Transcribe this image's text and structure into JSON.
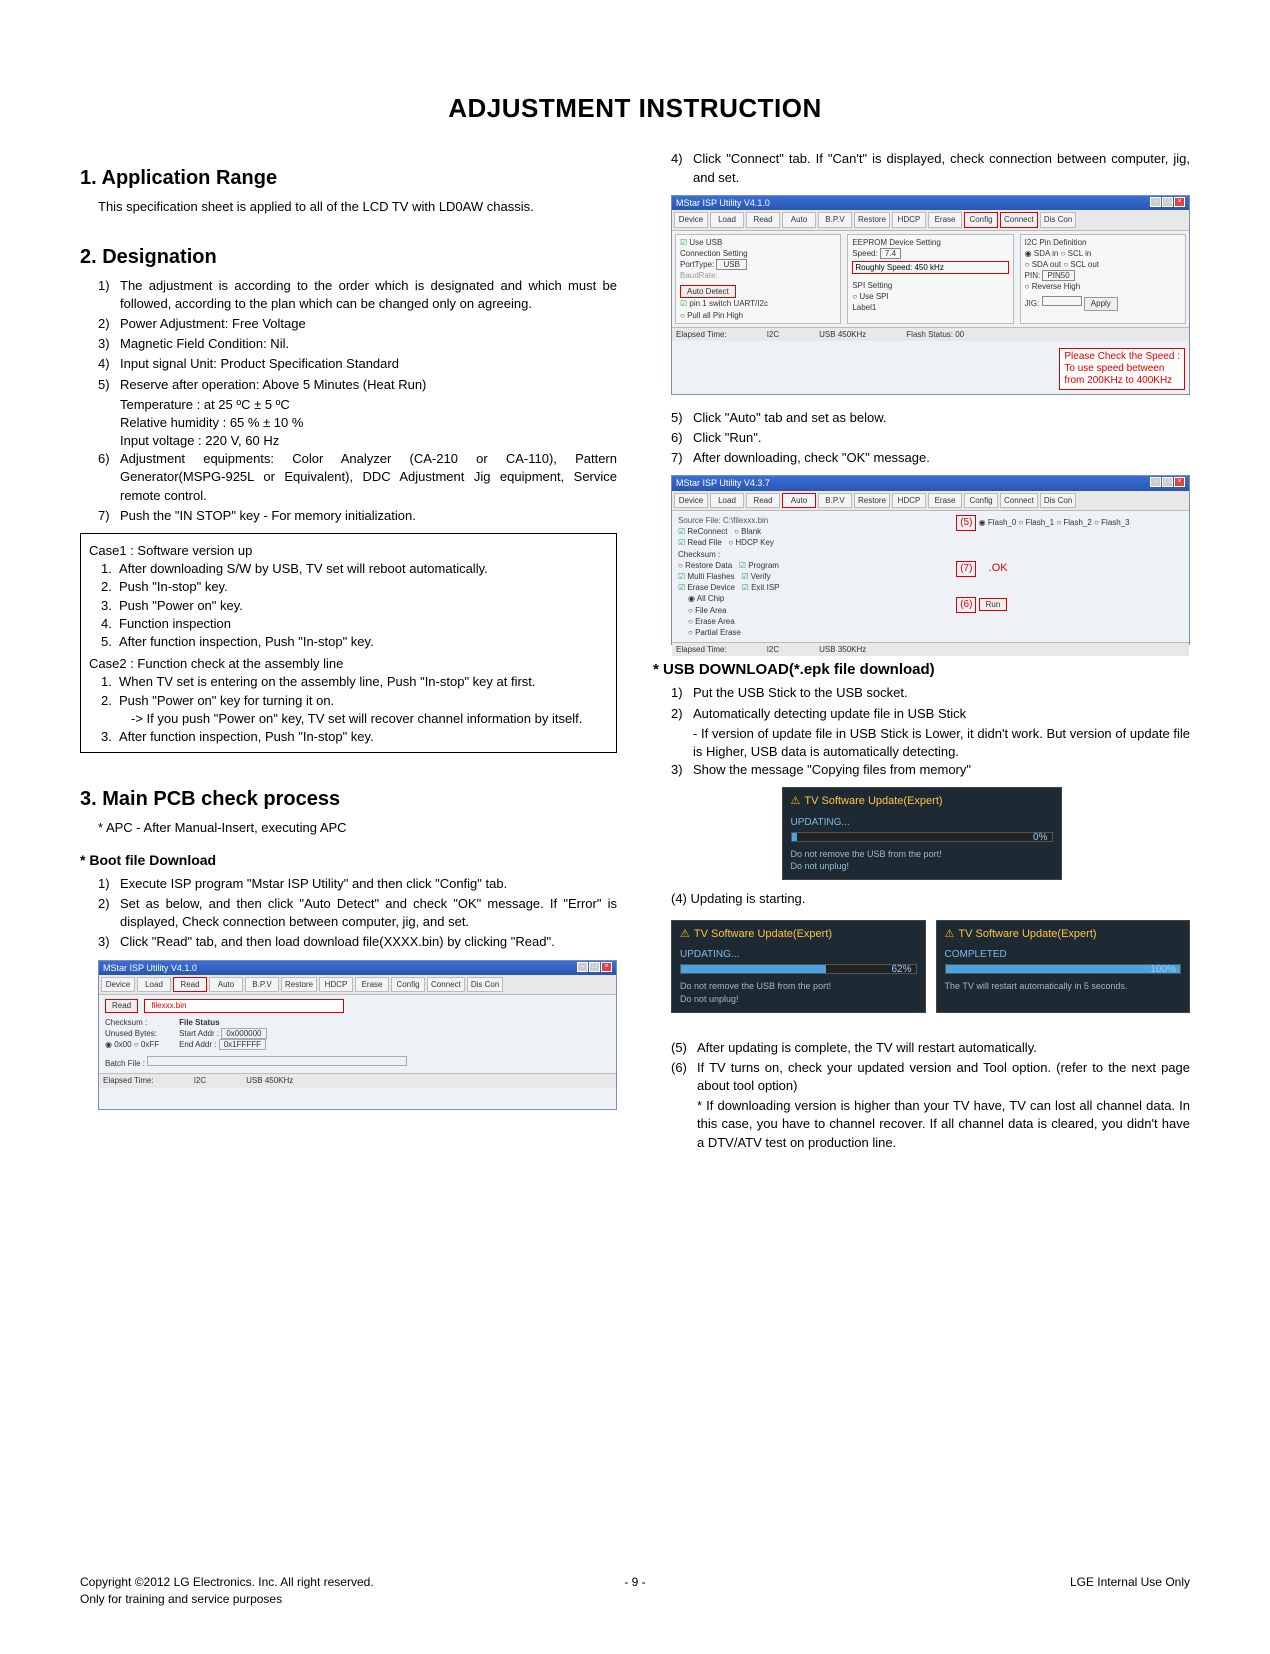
{
  "title": "ADJUSTMENT INSTRUCTION",
  "s1": {
    "heading": "1. Application Range",
    "intro": "This specification sheet is applied to all of the LCD TV with LD0AW chassis."
  },
  "s2": {
    "heading": "2. Designation",
    "items": {
      "i1": "1)",
      "t1": "The adjustment is according to the order which is designated and which must be followed, according to the plan which can be changed only on agreeing.",
      "i2": "2)",
      "t2": "Power Adjustment: Free Voltage",
      "i3": "3)",
      "t3": "Magnetic Field Condition: Nil.",
      "i4": "4)",
      "t4": "Input signal Unit: Product Specification Standard",
      "i5": "5)",
      "t5": "Reserve after operation: Above 5 Minutes (Heat Run)",
      "t5a": "Temperature : at 25 ºC ± 5 ºC",
      "t5b": "Relative humidity : 65 % ± 10 %",
      "t5c": "Input voltage : 220 V, 60 Hz",
      "i6": "6)",
      "t6": "Adjustment equipments: Color Analyzer (CA-210 or CA-110), Pattern Generator(MSPG-925L or Equivalent), DDC Adjustment Jig equipment, Service remote control.",
      "i7": "7)",
      "t7": "Push the \"IN STOP\" key - For memory initialization."
    },
    "case": {
      "c1h": "Case1 : Software version up",
      "c1_1n": "1.",
      "c1_1": "After downloading S/W by USB, TV set will reboot automatically.",
      "c1_2n": "2.",
      "c1_2": "Push \"In-stop\" key.",
      "c1_3n": "3.",
      "c1_3": "Push \"Power on\" key.",
      "c1_4n": "4.",
      "c1_4": "Function inspection",
      "c1_5n": "5.",
      "c1_5": "After function inspection, Push \"In-stop\" key.",
      "c2h": "Case2 : Function check at the assembly line",
      "c2_1n": "1.",
      "c2_1": "When TV set is entering on the assembly line, Push \"In-stop\" key at first.",
      "c2_2n": "2.",
      "c2_2": "Push \"Power on\" key for turning it on.",
      "c2_2a": "-> If you push \"Power on\" key, TV set will recover channel information by itself.",
      "c2_3n": "3.",
      "c2_3": "After function inspection, Push \"In-stop\" key."
    }
  },
  "s3": {
    "heading": "3. Main PCB check process",
    "apc": "* APC - After Manual-Insert, executing APC",
    "boot_h": "* Boot file Download",
    "b1n": "1)",
    "b1": "Execute ISP program \"Mstar ISP Utility\" and then click \"Config\" tab.",
    "b2n": "2)",
    "b2": "Set as below, and then click \"Auto Detect\" and check \"OK\" message. If \"Error\" is displayed, Check connection between computer, jig, and set.",
    "b3n": "3)",
    "b3": "Click \"Read\" tab, and then load download file(XXXX.bin) by clicking \"Read\"."
  },
  "shot1": {
    "title": "MStar ISP Utility V4.1.0",
    "tb": {
      "device": "Device",
      "load": "Load",
      "read": "Read",
      "auto": "Auto",
      "bpv": "B.P.V",
      "restore": "Restore",
      "hdcp": "HDCP",
      "erase": "Erase",
      "config": "Config",
      "connect": "Connect",
      "discon": "Dis Con"
    },
    "read_btn": "Read",
    "file": "filexxx.bin",
    "checksum": "Checksum :",
    "unused": "Unused Bytes:",
    "r0": "0x00",
    "r1": "0xFF",
    "filestatus": "File Status",
    "start": "Start Addr :",
    "startv": "0x000000",
    "end": "End Addr :",
    "endv": "0x1FFFFF",
    "batch": "Batch File :",
    "status_et": "Elapsed Time:",
    "status_i2c": "I2C",
    "status_usb": "USB 450KHz"
  },
  "right": {
    "r4n": "4)",
    "r4": "Click \"Connect\" tab. If \"Can't\" is displayed, check connection between computer, jig, and set."
  },
  "shot2": {
    "title": "MStar ISP Utility V4.1.0",
    "useusb": "Use USB",
    "comm": "Connection Setting",
    "port": "PortType:",
    "portv": "USB",
    "baud": "BaudRate:",
    "autodet": "Auto Detect",
    "pin": "pin 1 switch UART/I2c",
    "pull": "Pull all Pin High",
    "eeprom": "EEPROM Device Setting",
    "speed": "Speed:",
    "speedv": "7.4",
    "rough": "Roughly Speed: 450 kHz",
    "spi": "SPI Setting",
    "usespi": "Use SPI",
    "label": "Label1",
    "i2c": "I2C Pin Definition",
    "sdain": "SDA in",
    "sclin": "SCL in",
    "sdaout": "SDA out",
    "sclout": "SCL out",
    "pinl": "PIN:",
    "pinv": "PIN50",
    "rev": "Reverse High",
    "jig": "JIG:",
    "apply": "Apply",
    "status_et": "Elapsed Time:",
    "status_i2c": "I2C",
    "status_usb": "USB 450KHz",
    "status_flash": "Flash Status: 00",
    "red1": "Please Check the Speed :",
    "red2": "To use speed between",
    "red3": "from 200KHz  to 400KHz"
  },
  "right2": {
    "r5n": "5)",
    "r5": "Click \"Auto\" tab and set as below.",
    "r6n": "6)",
    "r6": "Click \"Run\".",
    "r7n": "7)",
    "r7": "After downloading, check \"OK\" message."
  },
  "shot3": {
    "title": "MStar ISP Utility V4.3.7",
    "src": "Source File: C:\\filexxx.bin",
    "reconnect": "ReConnect",
    "blank": "Blank",
    "readfile": "Read File",
    "hdcpkey": "HDCP Key",
    "checksum": "Checksum :",
    "restore": "Restore Data",
    "program": "Program",
    "multi": "Multi Flashes",
    "verify": "Verify",
    "erase": "Erase Device",
    "exit": "Exit ISP",
    "allchip": "All Chip",
    "filearea": "File Area",
    "erasearea": "Erase Area",
    "partial": "Partial Erase",
    "run": "Run",
    "five": "(5)",
    "flash0": "Flash_0",
    "flash1": "Flash_1",
    "flash2": "Flash_2",
    "flash3": "Flash_3",
    "six": "(6)",
    "seven": "(7)",
    "ok": ".OK",
    "status_et": "Elapsed Time:",
    "status_i2c": "I2C",
    "status_usb": "USB 350KHz"
  },
  "usb": {
    "heading": "* USB DOWNLOAD(*.epk file download)",
    "u1n": "1)",
    "u1": "Put the USB Stick to the USB socket.",
    "u2n": "2)",
    "u2": "Automatically detecting update file in USB Stick",
    "u2a": "- If version of update file in USB Stick is Lower, it didn't work. But version of update file is Higher, USB data is automatically detecting.",
    "u3n": "3)",
    "u3": "Show the message \"Copying files from memory\""
  },
  "upd1": {
    "hdr": "TV Software Update(Expert)",
    "up": "UPDATING...",
    "pct": "0%",
    "l1": "Do not remove the USB from the port!",
    "l2": "Do not unplug!"
  },
  "after4": "(4) Updating is starting.",
  "upd2a": {
    "hdr": "TV Software Update(Expert)",
    "up": "UPDATING...",
    "pct": "62%",
    "l1": "Do not remove the USB from the port!",
    "l2": "Do not unplug!"
  },
  "upd2b": {
    "hdr": "TV Software Update(Expert)",
    "up": "COMPLETED",
    "pct": "100%",
    "l1": "The TV will restart automatically in 5 seconds."
  },
  "after": {
    "a5n": "(5)",
    "a5": "After updating is complete, the TV will restart automatically.",
    "a6n": "(6)",
    "a6": "If TV turns on, check your updated version and Tool option. (refer to the next page about tool option)",
    "a6s": "* If downloading version is higher than your TV have, TV can lost all channel data. In this case, you have to channel recover. If all channel data is cleared, you didn't have a DTV/ATV test on production line."
  },
  "footer": {
    "left1": "Copyright ©2012 LG Electronics. Inc. All right reserved.",
    "left2": "Only for training and service purposes",
    "page": "- 9 -",
    "right": "LGE Internal Use Only"
  }
}
